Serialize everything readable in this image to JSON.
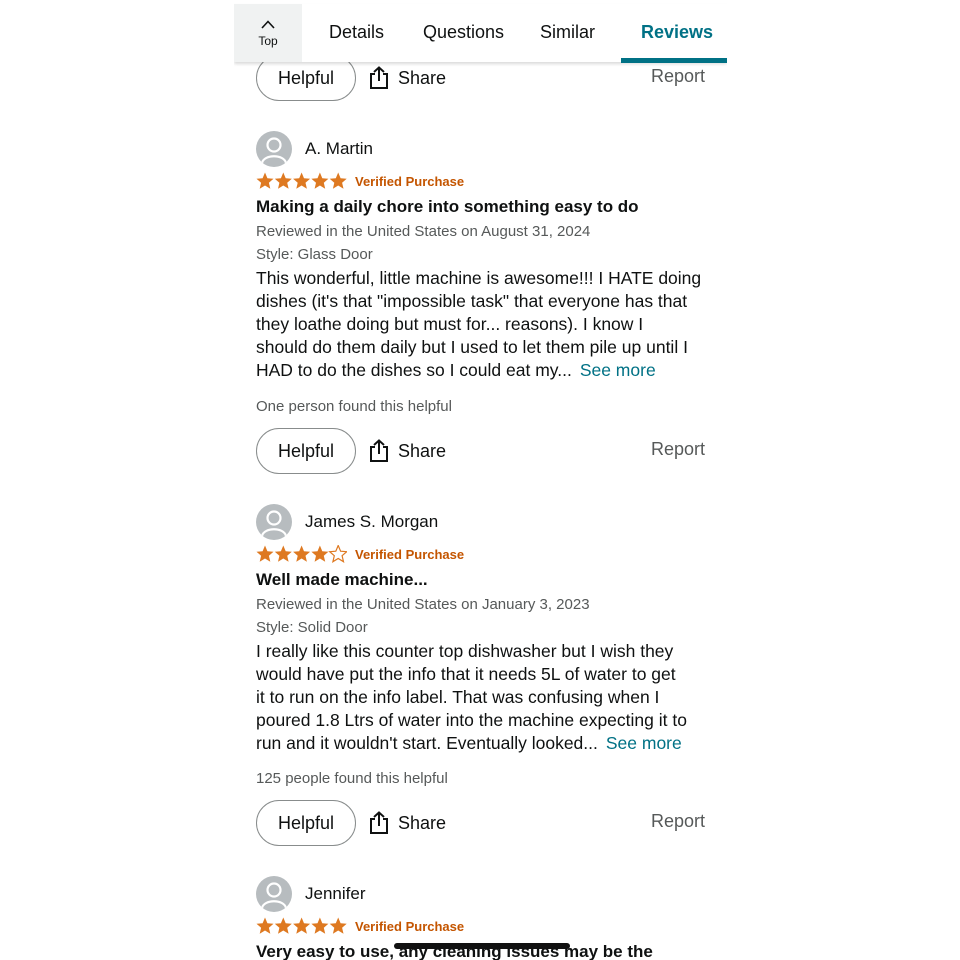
{
  "tabbar": {
    "top_label": "Top",
    "tabs": [
      "Details",
      "Questions",
      "Similar",
      "Reviews"
    ],
    "active_tab": "Reviews"
  },
  "actions": {
    "helpful_label": "Helpful",
    "share_label": "Share",
    "report_label": "Report"
  },
  "reviews": [
    {
      "name": "A. Martin",
      "rating": 5,
      "verified": "Verified Purchase",
      "title": "Making a daily chore into something easy to do",
      "reviewed": "Reviewed in the United States on August 31, 2024",
      "style": "Style: Glass Door",
      "body_lines": [
        "This wonderful, little machine is awesome!!! I HATE doing",
        "dishes (it's that \"impossible task\" that everyone has that",
        "they loathe doing but must for... reasons). I know I",
        "should do them daily but I used to let them pile up until I",
        "HAD to do the dishes so I could eat my..."
      ],
      "see_more": "See more",
      "found_helpful": "One person found this helpful"
    },
    {
      "name": "James S. Morgan",
      "rating": 4,
      "verified": "Verified Purchase",
      "title": "Well made machine...",
      "reviewed": "Reviewed in the United States on January 3, 2023",
      "style": "Style: Solid Door",
      "body_lines": [
        "I really like this counter top dishwasher but I wish they",
        "would have put the info that it needs 5L of water to get",
        "it to run on the info label. That was confusing when I",
        "poured 1.8 Ltrs of water into the machine expecting it to",
        "run and it wouldn't start. Eventually looked..."
      ],
      "see_more": "See more",
      "found_helpful": "125 people found this helpful"
    },
    {
      "name": "Jennifer",
      "rating": 5,
      "verified": "Verified Purchase",
      "title": "Very easy to use, any cleaning issues may be the"
    }
  ],
  "colors": {
    "star": "#de7921",
    "accent": "#007185",
    "verified": "#c45500"
  }
}
